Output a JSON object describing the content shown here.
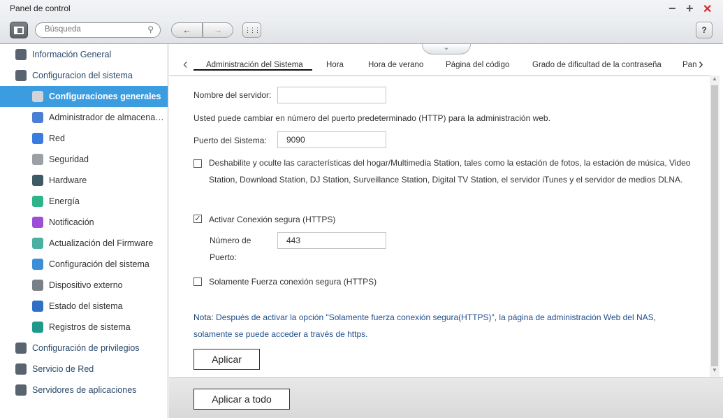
{
  "window": {
    "title": "Panel de control",
    "minimize": "−",
    "maximize": "+",
    "close": "✕"
  },
  "toolbar": {
    "search_placeholder": "Búsqueda",
    "back": "←",
    "forward": "→",
    "apps": "⋮⋮⋮",
    "help": "?"
  },
  "sidebar": {
    "items": [
      {
        "label": "Información General",
        "level": "top",
        "icon": "grid-icon",
        "color": "#5a6470"
      },
      {
        "label": "Configuracion del sistema",
        "level": "top",
        "icon": "gear-icon",
        "color": "#5a6470"
      },
      {
        "label": "Configuraciones generales",
        "level": "sub",
        "active": true,
        "icon": "settings-doc-icon",
        "color": "#d0d4d8"
      },
      {
        "label": "Administrador de almacena…",
        "level": "sub",
        "icon": "storage-icon",
        "color": "#4a7fd6"
      },
      {
        "label": "Red",
        "level": "sub",
        "icon": "network-icon",
        "color": "#3a7be0"
      },
      {
        "label": "Seguridad",
        "level": "sub",
        "icon": "lock-icon",
        "color": "#9aa0a6"
      },
      {
        "label": "Hardware",
        "level": "sub",
        "icon": "hardware-icon",
        "color": "#3d5a66"
      },
      {
        "label": "Energía",
        "level": "sub",
        "icon": "bulb-icon",
        "color": "#2fb38a"
      },
      {
        "label": "Notificación",
        "level": "sub",
        "icon": "notification-icon",
        "color": "#9a4fd6"
      },
      {
        "label": "Actualización del Firmware",
        "level": "sub",
        "icon": "firmware-icon",
        "color": "#4ab0a0"
      },
      {
        "label": "Configuración del sistema",
        "level": "sub",
        "icon": "system-config-icon",
        "color": "#3a8fd6"
      },
      {
        "label": "Dispositivo externo",
        "level": "sub",
        "icon": "external-device-icon",
        "color": "#7a8088"
      },
      {
        "label": "Estado del sistema",
        "level": "sub",
        "icon": "monitor-icon",
        "color": "#2f6fc6"
      },
      {
        "label": "Registros de sistema",
        "level": "sub",
        "icon": "log-icon",
        "color": "#1f9a8a"
      },
      {
        "label": "Configuración de privilegios",
        "level": "top",
        "icon": "user-icon",
        "color": "#5a6470"
      },
      {
        "label": "Servicio de Red",
        "level": "top",
        "icon": "globe-icon",
        "color": "#5a6470"
      },
      {
        "label": "Servidores de aplicaciones",
        "level": "top",
        "icon": "server-icon",
        "color": "#5a6470"
      }
    ]
  },
  "tabs": {
    "items": [
      "Administración del Sistema",
      "Hora",
      "Hora de verano",
      "Página del código",
      "Grado de dificultad de la contraseña",
      "Pan"
    ],
    "active": 0
  },
  "form": {
    "server_name_label": "Nombre del servidor:",
    "server_name_value": "",
    "port_info": "Usted puede cambiar en número del puerto predeterminado (HTTP) para la administración web.",
    "system_port_label": "Puerto del Sistema:",
    "system_port_value": "9090",
    "disable_multimedia_label": "Deshabilite y oculte las características del hogar/Multimedia Station, tales como la estación de fotos, la estación de música, Video Station, Download Station, DJ Station, Surveillance Station, Digital TV Station, el servidor iTunes y el servidor de medios DLNA.",
    "disable_multimedia_checked": false,
    "https_label": "Activar Conexión segura (HTTPS)",
    "https_checked": true,
    "https_port_label": "Número de Puerto:",
    "https_port_value": "443",
    "force_https_label": "Solamente Fuerza conexión segura (HTTPS)",
    "force_https_checked": false,
    "note_prefix": "Nota:",
    "note_text": " Después de activar la opción \"Solamente fuerza conexión segura(HTTPS)\", la página de administración Web del NAS, solamente se puede acceder a través de https.",
    "apply": "Aplicar",
    "apply_all": "Aplicar a todo"
  },
  "colors": {
    "accent": "#3b9de0",
    "note": "#1f4e8c"
  }
}
